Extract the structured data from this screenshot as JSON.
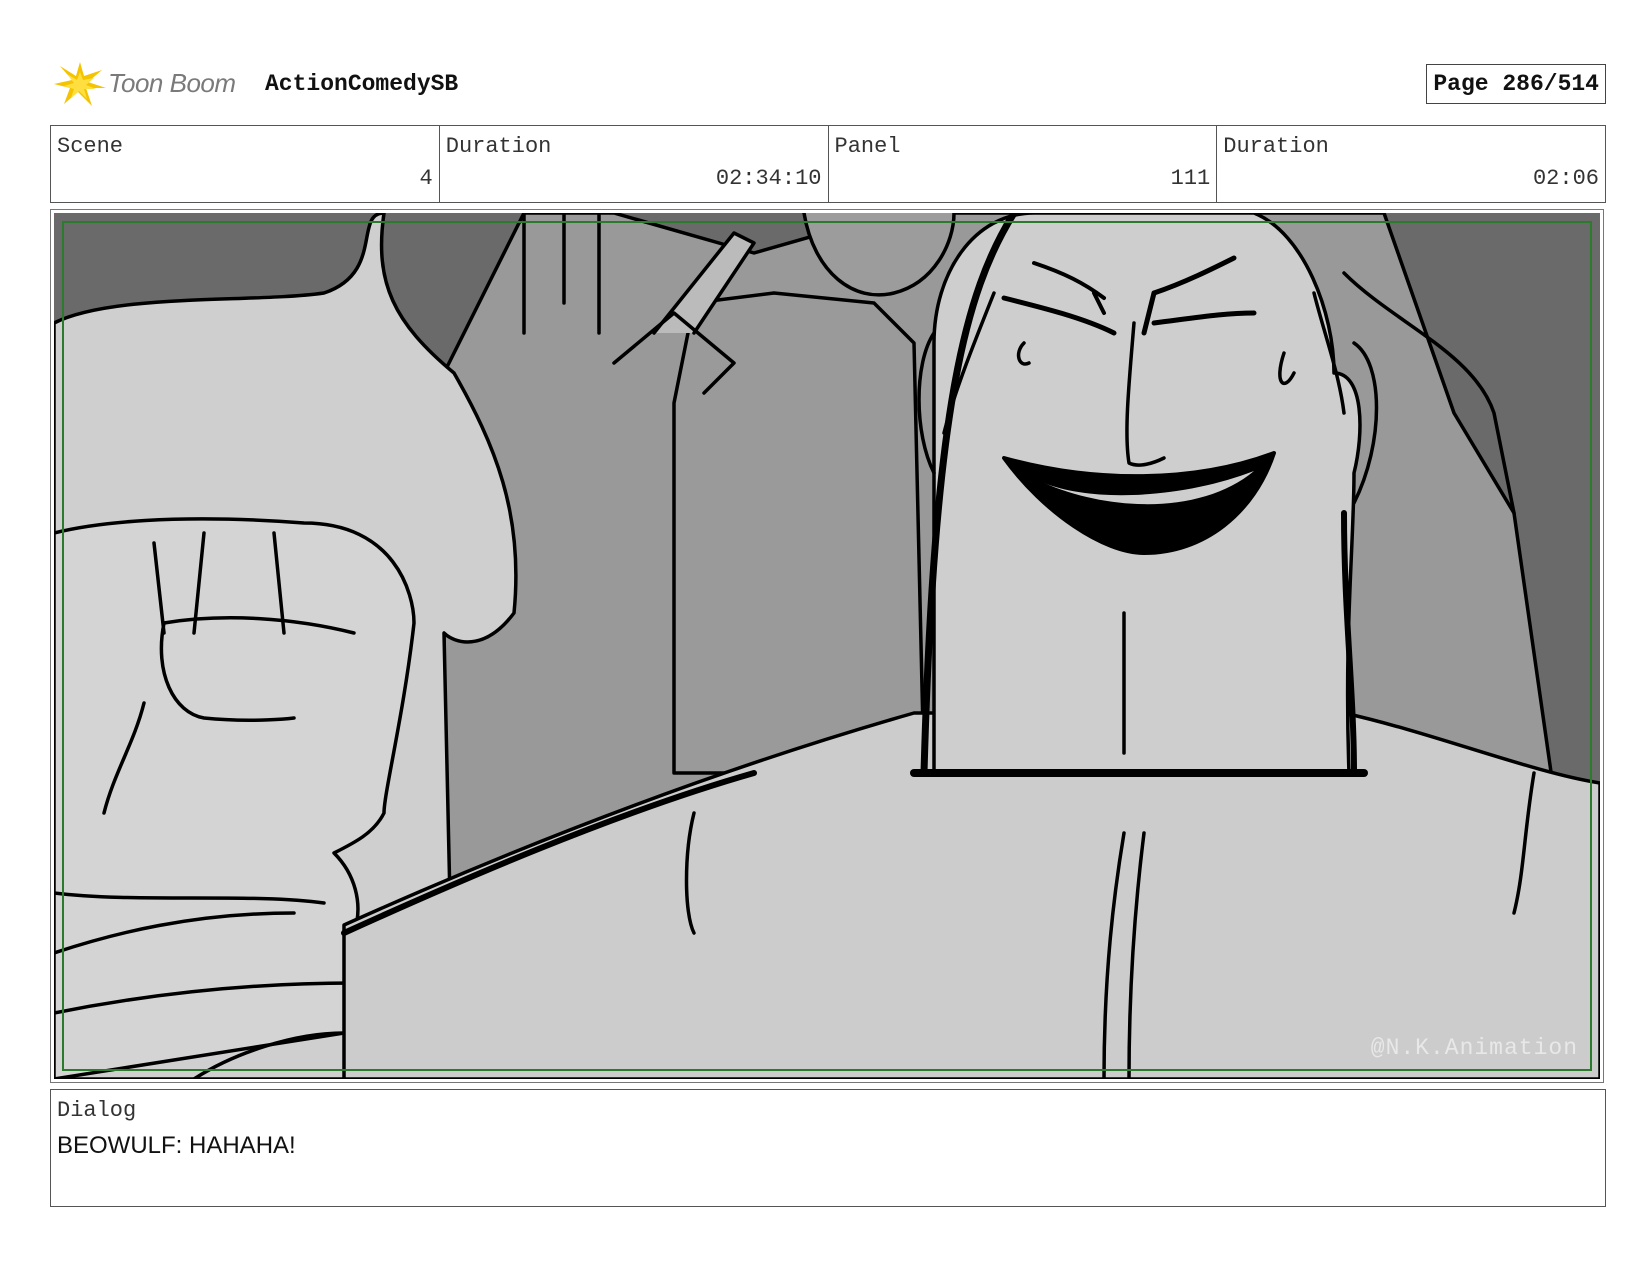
{
  "header": {
    "logo_text": "Toon Boom",
    "project_title": "ActionComedySB",
    "page_indicator": "Page 286/514"
  },
  "info": {
    "scene_label": "Scene",
    "scene_value": "4",
    "scene_duration_label": "Duration",
    "scene_duration_value": "02:34:10",
    "panel_label": "Panel",
    "panel_value": "111",
    "panel_duration_label": "Duration",
    "panel_duration_value": "02:06"
  },
  "panel": {
    "watermark": "@N.K.Animation"
  },
  "dialog": {
    "label": "Dialog",
    "text": "BEOWULF: HAHAHA!"
  },
  "colors": {
    "safe_frame": "#2c7a2c",
    "logo_accent": "#f5c400"
  }
}
